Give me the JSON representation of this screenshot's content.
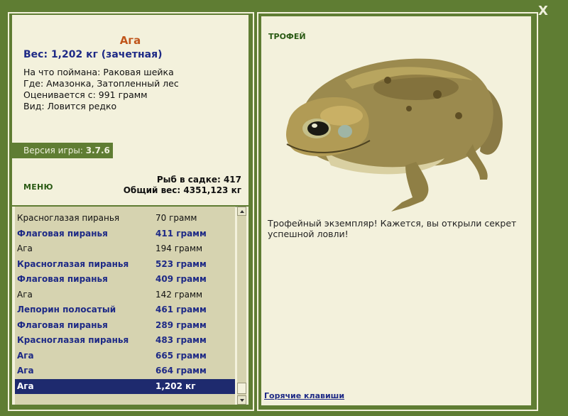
{
  "window": {
    "close_label": "X"
  },
  "catch": {
    "name": "Ага",
    "weight_line": "Вес: 1,202 кг (зачетная)",
    "caught_on": "На что поймана: Раковая шейка",
    "location": "Где: Амазонка, Затопленный лес",
    "valued_from": "Оценивается с: 991 грамм",
    "kind": "Вид: Ловится редко"
  },
  "version": {
    "label": "Версия игры:",
    "value": "3.7.6"
  },
  "menu": {
    "label": "МЕНЮ"
  },
  "stats": {
    "fish_in_keepnet": "Рыб в садке: 417",
    "total_weight": "Общий вес: 4351,123 кг"
  },
  "catch_list": [
    {
      "name": "Красноглазая пиранья",
      "weight": "70 грамм",
      "style": "normal"
    },
    {
      "name": "Флаговая пиранья",
      "weight": "411 грамм",
      "style": "bold"
    },
    {
      "name": "Ага",
      "weight": "194 грамм",
      "style": "normal"
    },
    {
      "name": "Красноглазая пиранья",
      "weight": "523 грамм",
      "style": "bold"
    },
    {
      "name": "Флаговая пиранья",
      "weight": "409 грамм",
      "style": "bold"
    },
    {
      "name": "Ага",
      "weight": "142 грамм",
      "style": "normal"
    },
    {
      "name": "Лепорин полосатый",
      "weight": "461 грамм",
      "style": "bold"
    },
    {
      "name": "Флаговая пиранья",
      "weight": "289 грамм",
      "style": "bold"
    },
    {
      "name": "Красноглазая пиранья",
      "weight": "483 грамм",
      "style": "bold"
    },
    {
      "name": "Ага",
      "weight": "665 грамм",
      "style": "bold"
    },
    {
      "name": "Ага",
      "weight": "664 грамм",
      "style": "bold"
    },
    {
      "name": "Ага",
      "weight": "1,202 кг",
      "style": "selected"
    }
  ],
  "trophy": {
    "label": "ТРОФЕЙ",
    "text": "Трофейный экземпляр! Кажется, вы открыли секрет успешной ловли!",
    "image_icon": "cane-toad-image"
  },
  "footer": {
    "hotkeys_label": "Горячие клавиши"
  },
  "colors": {
    "frame_green": "#5f7d33",
    "panel_cream": "#f3f1dc",
    "list_bg": "#d6d3b0",
    "title_orange": "#c0561c",
    "accent_navy": "#1e2a86",
    "selected_row": "#1e2a6e"
  }
}
